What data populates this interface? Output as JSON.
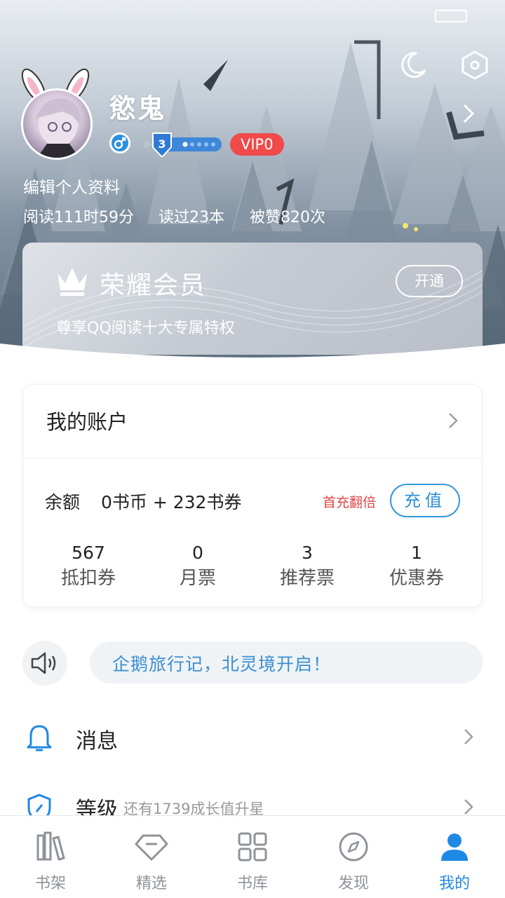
{
  "profile": {
    "nickname": "慾鬼",
    "level": "3",
    "vip_level": "VIP0",
    "edit_label": "编辑个人资料",
    "stats": {
      "reading_time": "阅读111时59分",
      "books_read": "读过23本",
      "likes": "被赞820次"
    }
  },
  "vip_card": {
    "title": "荣耀会员",
    "description": "尊享QQ阅读十大专属特权",
    "open_label": "开通"
  },
  "account": {
    "title": "我的账户",
    "balance_label": "余额",
    "balance_value": "0书币 + 232书券",
    "first_charge_label": "首充翻倍",
    "recharge_label": "充值",
    "tickets": [
      {
        "value": "567",
        "label": "抵扣券"
      },
      {
        "value": "0",
        "label": "月票"
      },
      {
        "value": "3",
        "label": "推荐票"
      },
      {
        "value": "1",
        "label": "优惠券"
      }
    ]
  },
  "announcement": "企鹅旅行记，北灵境开启！",
  "menu": {
    "messages": "消息",
    "level": "等级",
    "level_sub": "还有1739成长值升星"
  },
  "tabs": [
    {
      "label": "书架",
      "icon": "bookshelf-icon"
    },
    {
      "label": "精选",
      "icon": "diamond-icon"
    },
    {
      "label": "书库",
      "icon": "grid-icon"
    },
    {
      "label": "发现",
      "icon": "compass-icon"
    },
    {
      "label": "我的",
      "icon": "user-icon"
    }
  ],
  "colors": {
    "accent": "#1e88e5",
    "vip_red": "#f04a4a",
    "first_charge_red": "#e04646"
  }
}
